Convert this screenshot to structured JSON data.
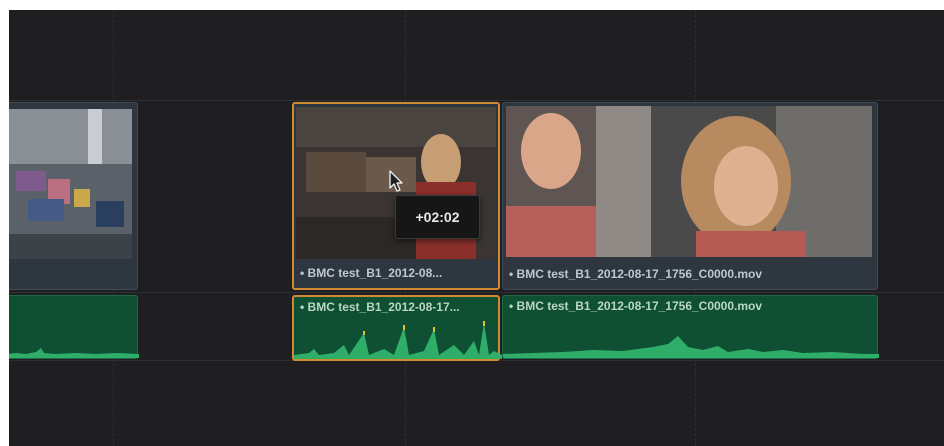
{
  "colors": {
    "timeline_bg": "#1f1f21",
    "video_clip_bg": "#2e3740",
    "audio_clip_bg": "#0f4f33",
    "selection_border": "#d08a33",
    "waveform": "#2fae6a",
    "waveform_peak": "#e5c12a"
  },
  "video_track": {
    "clips": [
      {
        "label": ""
      },
      {
        "label": "BMC test_B1_2012-08..."
      },
      {
        "label": "BMC test_B1_2012-08-17_1756_C0000.mov"
      }
    ]
  },
  "audio_track": {
    "clips": [
      {
        "label": ""
      },
      {
        "label": "BMC test_B1_2012-08-17..."
      },
      {
        "label": "BMC test_B1_2012-08-17_1756_C0000.mov"
      }
    ]
  },
  "drag_tooltip": {
    "offset": "+02:02"
  },
  "icons": {
    "cursor": "arrow-pointer-icon"
  }
}
